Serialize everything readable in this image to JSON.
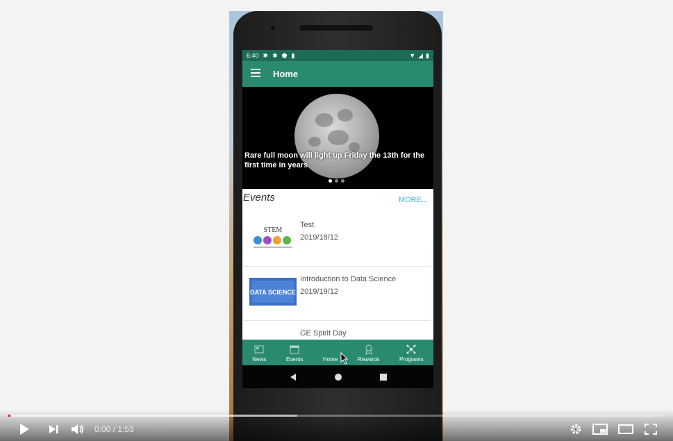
{
  "status_bar": {
    "time": "6:40"
  },
  "app_bar": {
    "title": "Home"
  },
  "carousel": {
    "caption": "Rare full moon will light up Friday the 13th for the first time in years",
    "slide_count": 3,
    "active_index": 0
  },
  "events": {
    "title": "Events",
    "more_label": "MORE...",
    "items": [
      {
        "name": "Test",
        "date": "2019/18/12",
        "thumb_text": "STEM"
      },
      {
        "name": "Introduction to Data Science",
        "date": "2019/19/12",
        "thumb_text": "DATA SCIENCE"
      },
      {
        "name": "GE Spirit Day",
        "date": ""
      }
    ]
  },
  "bottom_nav": [
    {
      "label": "News",
      "icon": "newspaper-icon"
    },
    {
      "label": "Events",
      "icon": "calendar-icon"
    },
    {
      "label": "Home",
      "icon": "home-icon"
    },
    {
      "label": "Rewards",
      "icon": "award-icon"
    },
    {
      "label": "Programs",
      "icon": "network-icon"
    }
  ],
  "player": {
    "current_time": "0:00",
    "duration": "1:53",
    "time_display": "0:00 / 1:53",
    "played_fraction": 0.0,
    "buffered_fraction": 0.44
  },
  "colors": {
    "app_primary": "#2a8a70",
    "status_bar": "#1c6b55",
    "link": "#3db5d6",
    "progress_played": "#ff0000"
  }
}
